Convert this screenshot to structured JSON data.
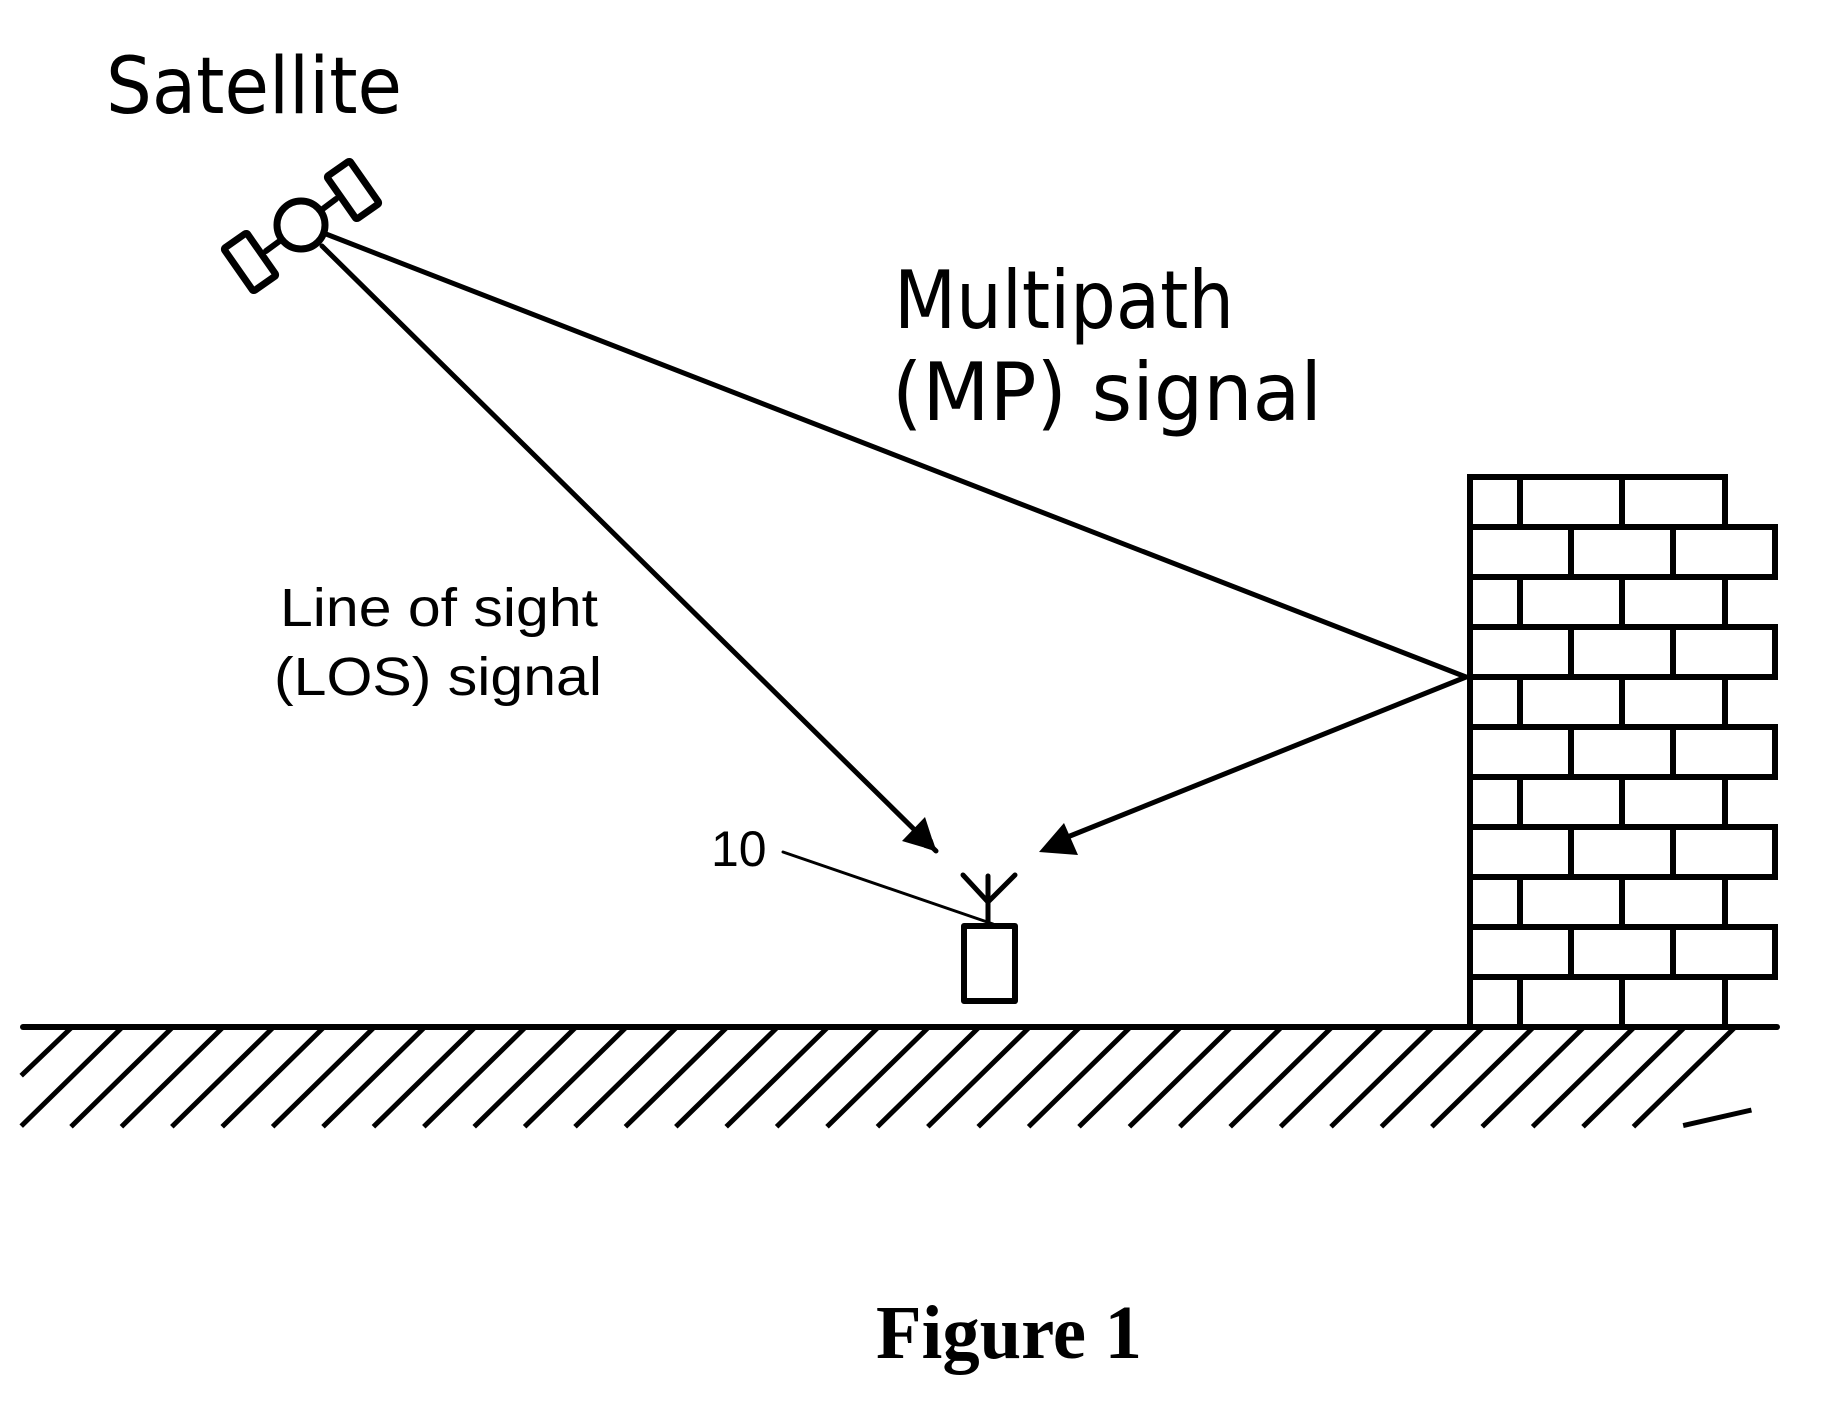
{
  "figure": {
    "caption": "Figure 1",
    "colors": {
      "ink": "#000000",
      "background": "#ffffff"
    },
    "labels": {
      "satellite": "Satellite",
      "multipath_line1": "Multipath",
      "multipath_line2": "(MP) signal",
      "los_line1": "Line of sight",
      "los_line2": "(LOS) signal",
      "receiver_ref": "10"
    },
    "elements": [
      {
        "id": "satellite",
        "icon": "satellite-icon"
      },
      {
        "id": "receiver",
        "icon": "antenna-receiver-icon",
        "reference_numeral": "10"
      },
      {
        "id": "wall",
        "icon": "brick-wall-icon"
      },
      {
        "id": "ground",
        "icon": "hatched-ground-icon"
      }
    ],
    "signals": [
      {
        "name": "Line of sight (LOS) signal",
        "from": "satellite",
        "to": "receiver"
      },
      {
        "name": "Multipath (MP) signal",
        "from": "satellite",
        "via": "wall",
        "to": "receiver"
      }
    ]
  }
}
